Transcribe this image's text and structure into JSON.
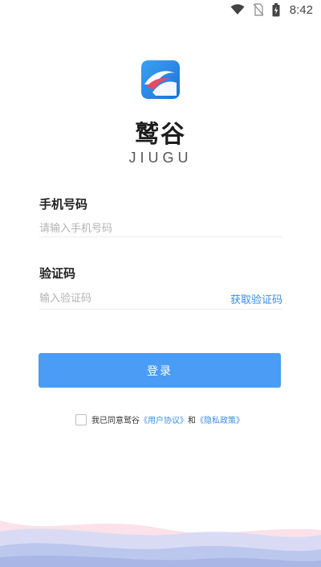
{
  "status_bar": {
    "time": "8:42",
    "icons": [
      "wifi-icon",
      "no-sim-icon",
      "battery-charging-icon"
    ]
  },
  "app": {
    "logo_icon": "eagle-logo-icon",
    "name": "鹫谷",
    "subname": "JIUGU"
  },
  "phone": {
    "label": "手机号码",
    "placeholder": "请输入手机号码",
    "value": ""
  },
  "code": {
    "label": "验证码",
    "placeholder": "输入验证码",
    "value": "",
    "get_code_label": "获取验证码"
  },
  "login_button": {
    "label": "登录"
  },
  "agreement": {
    "checked": false,
    "prefix": "我已同意鹫谷",
    "user_agreement": "《用户协议》",
    "conjunction": "和",
    "privacy_policy": "《隐私政策》"
  },
  "colors": {
    "accent": "#4a9cf5",
    "link": "#3a8ee6",
    "logo_blue": "#2f8be6"
  }
}
